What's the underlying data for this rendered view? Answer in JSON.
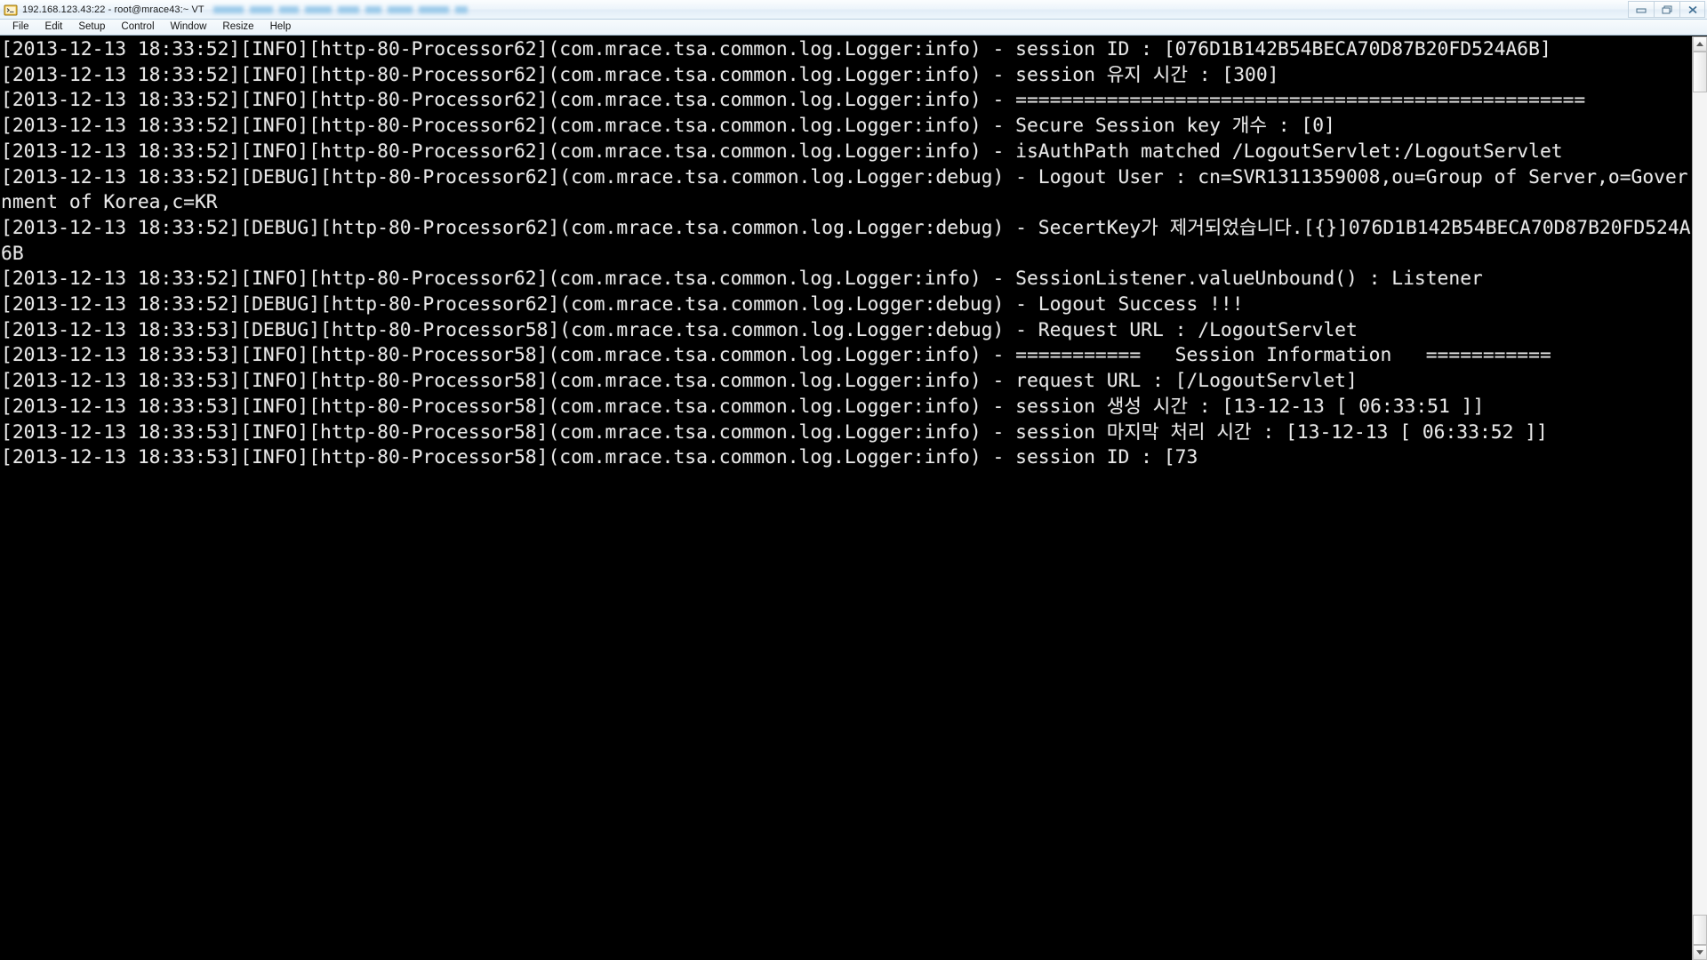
{
  "window": {
    "title": "192.168.123.43:22 - root@mrace43:~ VT",
    "redacted_suffix_present": true,
    "buttons": {
      "minimize": "minimize",
      "restore": "restore",
      "close": "close"
    }
  },
  "menubar": {
    "items": [
      {
        "label": "File"
      },
      {
        "label": "Edit"
      },
      {
        "label": "Setup"
      },
      {
        "label": "Control"
      },
      {
        "label": "Window"
      },
      {
        "label": "Resize"
      },
      {
        "label": "Help"
      }
    ]
  },
  "terminal": {
    "colors": {
      "background": "#000000",
      "foreground": "#e8e8e8"
    },
    "text": "[2013-12-13 18:33:52][INFO][http-80-Processor62](com.mrace.tsa.common.log.Logger:info) - session ID : [076D1B142B54BECA70D87B20FD524A6B]\n[2013-12-13 18:33:52][INFO][http-80-Processor62](com.mrace.tsa.common.log.Logger:info) - session 유지 시간 : [300]\n[2013-12-13 18:33:52][INFO][http-80-Processor62](com.mrace.tsa.common.log.Logger:info) - ==================================================\n[2013-12-13 18:33:52][INFO][http-80-Processor62](com.mrace.tsa.common.log.Logger:info) - Secure Session key 개수 : [0]\n[2013-12-13 18:33:52][INFO][http-80-Processor62](com.mrace.tsa.common.log.Logger:info) - isAuthPath matched /LogoutServlet:/LogoutServlet\n[2013-12-13 18:33:52][DEBUG][http-80-Processor62](com.mrace.tsa.common.log.Logger:debug) - Logout User : cn=SVR1311359008,ou=Group of Server,o=Government of Korea,c=KR\n[2013-12-13 18:33:52][DEBUG][http-80-Processor62](com.mrace.tsa.common.log.Logger:debug) - SecertKey가 제거되었습니다.[{}]076D1B142B54BECA70D87B20FD524A6B\n[2013-12-13 18:33:52][INFO][http-80-Processor62](com.mrace.tsa.common.log.Logger:info) - SessionListener.valueUnbound() : Listener\n[2013-12-13 18:33:52][DEBUG][http-80-Processor62](com.mrace.tsa.common.log.Logger:debug) - Logout Success !!!\n[2013-12-13 18:33:53][DEBUG][http-80-Processor58](com.mrace.tsa.common.log.Logger:debug) - Request URL : /LogoutServlet\n[2013-12-13 18:33:53][INFO][http-80-Processor58](com.mrace.tsa.common.log.Logger:info) - ===========   Session Information   ===========\n[2013-12-13 18:33:53][INFO][http-80-Processor58](com.mrace.tsa.common.log.Logger:info) - request URL : [/LogoutServlet]\n[2013-12-13 18:33:53][INFO][http-80-Processor58](com.mrace.tsa.common.log.Logger:info) - session 생성 시간 : [13-12-13 [ 06:33:51 ]]\n[2013-12-13 18:33:53][INFO][http-80-Processor58](com.mrace.tsa.common.log.Logger:info) - session 마지막 처리 시간 : [13-12-13 [ 06:33:52 ]]\n[2013-12-13 18:33:53][INFO][http-80-Processor58](com.mrace.tsa.common.log.Logger:info) - session ID : [73",
    "log_entries": [
      {
        "timestamp": "2013-12-13 18:33:52",
        "level": "INFO",
        "thread": "http-80-Processor62",
        "logger": "com.mrace.tsa.common.log.Logger:info",
        "message": "session ID : [076D1B142B54BECA70D87B20FD524A6B]"
      },
      {
        "timestamp": "2013-12-13 18:33:52",
        "level": "INFO",
        "thread": "http-80-Processor62",
        "logger": "com.mrace.tsa.common.log.Logger:info",
        "message": "session 유지 시간 : [300]"
      },
      {
        "timestamp": "2013-12-13 18:33:52",
        "level": "INFO",
        "thread": "http-80-Processor62",
        "logger": "com.mrace.tsa.common.log.Logger:info",
        "message": "=================================================="
      },
      {
        "timestamp": "2013-12-13 18:33:52",
        "level": "INFO",
        "thread": "http-80-Processor62",
        "logger": "com.mrace.tsa.common.log.Logger:info",
        "message": "Secure Session key 개수 : [0]"
      },
      {
        "timestamp": "2013-12-13 18:33:52",
        "level": "INFO",
        "thread": "http-80-Processor62",
        "logger": "com.mrace.tsa.common.log.Logger:info",
        "message": "isAuthPath matched /LogoutServlet:/LogoutServlet"
      },
      {
        "timestamp": "2013-12-13 18:33:52",
        "level": "DEBUG",
        "thread": "http-80-Processor62",
        "logger": "com.mrace.tsa.common.log.Logger:debug",
        "message": "Logout User : cn=SVR1311359008,ou=Group of Server,o=Government of Korea,c=KR"
      },
      {
        "timestamp": "2013-12-13 18:33:52",
        "level": "DEBUG",
        "thread": "http-80-Processor62",
        "logger": "com.mrace.tsa.common.log.Logger:debug",
        "message": "SecertKey가 제거되었습니다.[{}]076D1B142B54BECA70D87B20FD524A6B"
      },
      {
        "timestamp": "2013-12-13 18:33:52",
        "level": "INFO",
        "thread": "http-80-Processor62",
        "logger": "com.mrace.tsa.common.log.Logger:info",
        "message": "SessionListener.valueUnbound() : Listener"
      },
      {
        "timestamp": "2013-12-13 18:33:52",
        "level": "DEBUG",
        "thread": "http-80-Processor62",
        "logger": "com.mrace.tsa.common.log.Logger:debug",
        "message": "Logout Success !!!"
      },
      {
        "timestamp": "2013-12-13 18:33:53",
        "level": "DEBUG",
        "thread": "http-80-Processor58",
        "logger": "com.mrace.tsa.common.log.Logger:debug",
        "message": "Request URL : /LogoutServlet"
      },
      {
        "timestamp": "2013-12-13 18:33:53",
        "level": "INFO",
        "thread": "http-80-Processor58",
        "logger": "com.mrace.tsa.common.log.Logger:info",
        "message": "===========   Session Information   ==========="
      },
      {
        "timestamp": "2013-12-13 18:33:53",
        "level": "INFO",
        "thread": "http-80-Processor58",
        "logger": "com.mrace.tsa.common.log.Logger:info",
        "message": "request URL : [/LogoutServlet]"
      },
      {
        "timestamp": "2013-12-13 18:33:53",
        "level": "INFO",
        "thread": "http-80-Processor58",
        "logger": "com.mrace.tsa.common.log.Logger:info",
        "message": "session 생성 시간 : [13-12-13 [ 06:33:51 ]]"
      },
      {
        "timestamp": "2013-12-13 18:33:53",
        "level": "INFO",
        "thread": "http-80-Processor58",
        "logger": "com.mrace.tsa.common.log.Logger:info",
        "message": "session 마지막 처리 시간 : [13-12-13 [ 06:33:52 ]]"
      },
      {
        "timestamp": "2013-12-13 18:33:53",
        "level": "INFO",
        "thread": "http-80-Processor58",
        "logger": "com.mrace.tsa.common.log.Logger:info",
        "message": "session ID : [73"
      }
    ]
  }
}
